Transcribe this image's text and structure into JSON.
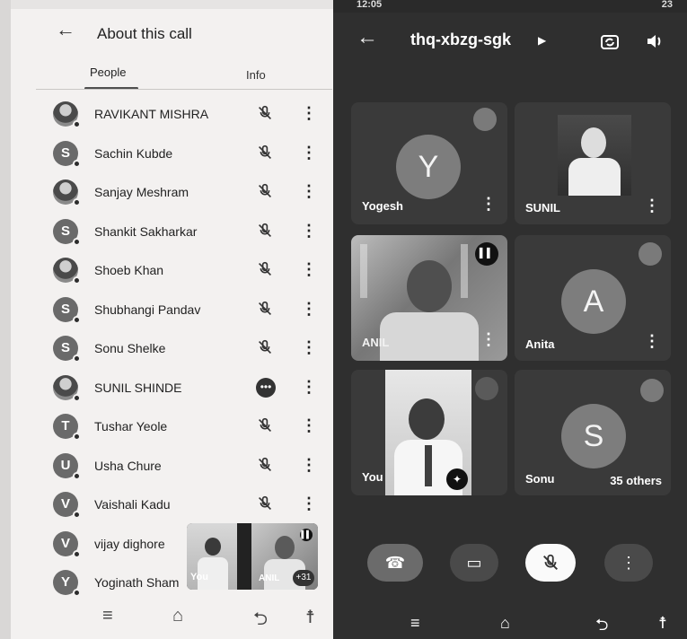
{
  "left_panel": {
    "title": "About this call",
    "tabs": [
      {
        "label": "People"
      },
      {
        "label": "Info"
      }
    ],
    "people": [
      {
        "name": "RAVIKANT MISHRA",
        "avatar": "photo",
        "status": "mic-off-icon"
      },
      {
        "name": "Sachin Kubde",
        "avatar": "S",
        "status": "mic-off-icon"
      },
      {
        "name": "Sanjay Meshram",
        "avatar": "photo",
        "status": "mic-off-icon"
      },
      {
        "name": "Shankit Sakharkar",
        "avatar": "S",
        "status": "mic-off-icon"
      },
      {
        "name": "Shoeb Khan",
        "avatar": "photo",
        "status": "mic-off-icon"
      },
      {
        "name": "Shubhangi Pandav",
        "avatar": "S",
        "status": "mic-off-icon"
      },
      {
        "name": "Sonu Shelke",
        "avatar": "S",
        "status": "mic-off-icon"
      },
      {
        "name": "SUNIL SHINDE",
        "avatar": "photo",
        "status": "more-dots-icon"
      },
      {
        "name": "Tushar Yeole",
        "avatar": "T",
        "status": "mic-off-icon"
      },
      {
        "name": "Usha Chure",
        "avatar": "U",
        "status": "mic-off-icon"
      },
      {
        "name": "Vaishali Kadu",
        "avatar": "V",
        "status": "mic-off-icon"
      },
      {
        "name": "vijay dighore",
        "avatar": "V",
        "status": "mic-off-icon"
      },
      {
        "name": "Yoginath Sham",
        "avatar": "Y",
        "status": "mic-off-icon"
      }
    ],
    "mini_strip": {
      "you_label": "You",
      "anil_label": "ANIL",
      "count": "+31"
    }
  },
  "right_panel": {
    "status_left": "12:05",
    "status_right": "23",
    "meeting_code": "thq-xbzg-sgk",
    "tiles": [
      {
        "name": "Yogesh",
        "avatar": "Y"
      },
      {
        "name": "SUNIL",
        "avatar": "photo"
      },
      {
        "name": "ANIL",
        "avatar": "video"
      },
      {
        "name": "Anita",
        "avatar": "A"
      },
      {
        "name": "You",
        "avatar": "video"
      },
      {
        "name": "Sonu",
        "avatar": "S",
        "others": "35 others"
      }
    ]
  },
  "colors": {
    "left_bg": "#f3f1f0",
    "right_bg": "#2f2f2f",
    "avatar_gray": "#6a6a6a"
  }
}
